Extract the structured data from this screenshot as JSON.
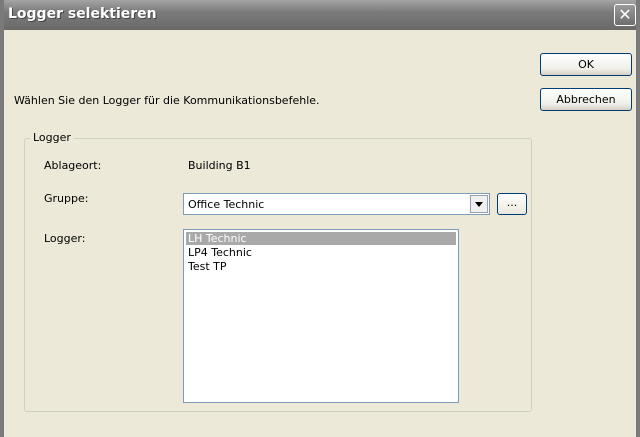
{
  "window": {
    "title": "Logger selektieren",
    "close_glyph": "✕"
  },
  "message": "Wählen Sie den Logger für die Kommunikationsbefehle.",
  "buttons": {
    "ok": "OK",
    "cancel": "Abbrechen",
    "browse": "..."
  },
  "group": {
    "label": "Logger",
    "ablageort_label": "Ablageort:",
    "ablageort_value": "Building B1",
    "gruppe_label": "Gruppe:",
    "gruppe_value": "Office Technic",
    "logger_label": "Logger:",
    "loggers": [
      "LH Technic",
      "LP4 Technic",
      "Test TP"
    ],
    "selected_logger": "LH Technic"
  }
}
